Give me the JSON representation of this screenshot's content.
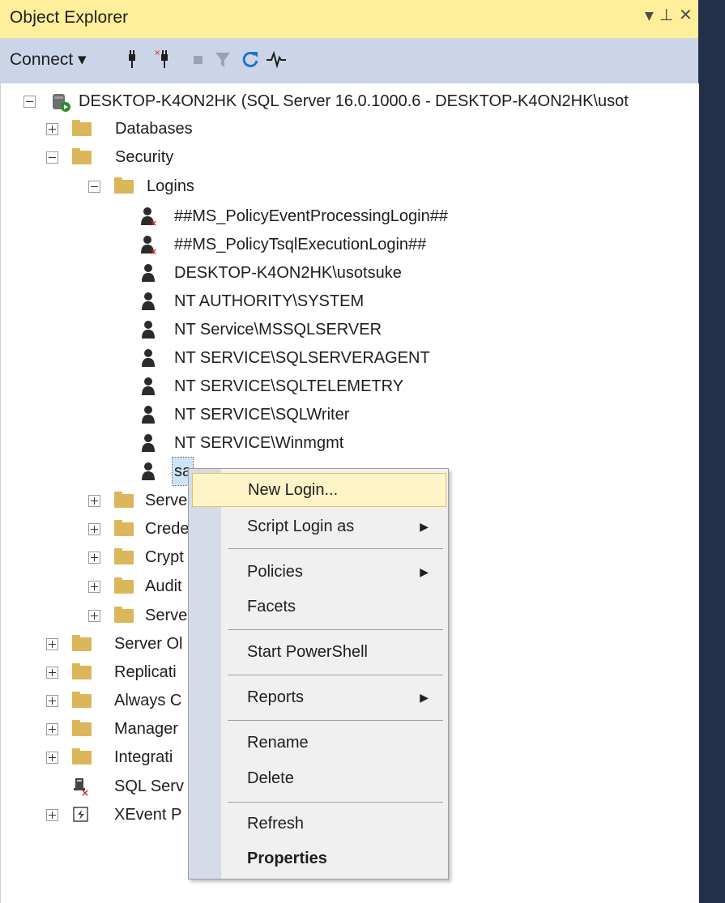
{
  "window": {
    "title": "Object Explorer"
  },
  "toolbar": {
    "connect_label": "Connect ▾"
  },
  "tree": {
    "server": "DESKTOP-K4ON2HK (SQL Server 16.0.1000.6 - DESKTOP-K4ON2HK\\usot",
    "databases": "Databases",
    "security": "Security",
    "logins": "Logins",
    "login_items": [
      "##MS_PolicyEventProcessingLogin##",
      "##MS_PolicyTsqlExecutionLogin##",
      "DESKTOP-K4ON2HK\\usotsuke",
      "NT AUTHORITY\\SYSTEM",
      "NT Service\\MSSQLSERVER",
      "NT SERVICE\\SQLSERVERAGENT",
      "NT SERVICE\\SQLTELEMETRY",
      "NT SERVICE\\SQLWriter",
      "NT SERVICE\\Winmgmt",
      "sa"
    ],
    "security_children": [
      "Serve",
      "Crede",
      "Crypt",
      "Audit",
      "Serve"
    ],
    "top_items": [
      "Server Ol",
      "Replicati",
      "Always C",
      "Manager",
      "Integrati",
      "SQL Serv",
      "XEvent P"
    ]
  },
  "context_menu": {
    "items": [
      {
        "label": "New Login..."
      },
      {
        "label": "Script Login as"
      },
      {
        "label": "Policies"
      },
      {
        "label": "Facets"
      },
      {
        "label": "Start PowerShell"
      },
      {
        "label": "Reports"
      },
      {
        "label": "Rename"
      },
      {
        "label": "Delete"
      },
      {
        "label": "Refresh"
      },
      {
        "label": "Properties"
      }
    ]
  },
  "colors": {
    "title_bg": "#ffef9a",
    "toolbar_bg": "#ccd5e8",
    "highlight": "#fff4c7"
  }
}
